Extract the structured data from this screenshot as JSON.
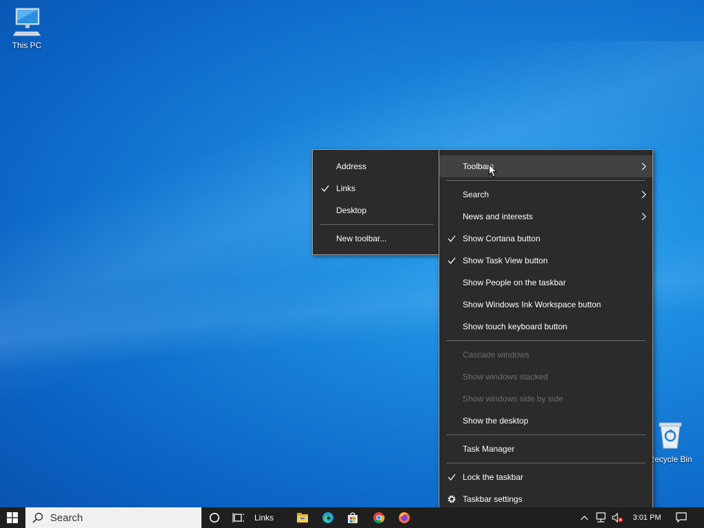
{
  "desktop": {
    "this_pc_label": "This PC",
    "recycle_bin_label": "Recycle Bin"
  },
  "context_menu": {
    "items": [
      {
        "label": "Toolbars",
        "submenu": true,
        "highlighted": true
      },
      {
        "label": "Search",
        "submenu": true
      },
      {
        "label": "News and interests",
        "submenu": true
      },
      {
        "label": "Show Cortana button",
        "checked": true
      },
      {
        "label": "Show Task View button",
        "checked": true
      },
      {
        "label": "Show People on the taskbar"
      },
      {
        "label": "Show Windows Ink Workspace button"
      },
      {
        "label": "Show touch keyboard button"
      },
      {
        "label": "Cascade windows",
        "disabled": true
      },
      {
        "label": "Show windows stacked",
        "disabled": true
      },
      {
        "label": "Show windows side by side",
        "disabled": true
      },
      {
        "label": "Show the desktop"
      },
      {
        "label": "Task Manager"
      },
      {
        "label": "Lock the taskbar",
        "checked": true
      },
      {
        "label": "Taskbar settings",
        "icon": "gear-icon"
      }
    ]
  },
  "toolbars_submenu": {
    "items": [
      {
        "label": "Address"
      },
      {
        "label": "Links",
        "checked": true
      },
      {
        "label": "Desktop"
      },
      {
        "label": "New toolbar..."
      }
    ]
  },
  "taskbar": {
    "search_placeholder": "Search",
    "links_label": "Links",
    "clock": "3:01 PM",
    "apps": [
      "file-explorer-icon",
      "edge-icon",
      "store-icon",
      "chrome-icon",
      "firefox-icon"
    ]
  },
  "colors": {
    "menu_bg": "#2b2b2b",
    "menu_highlight": "#414141",
    "disabled_text": "#6d6d6d",
    "taskbar_bg": "#1f1f1f"
  }
}
